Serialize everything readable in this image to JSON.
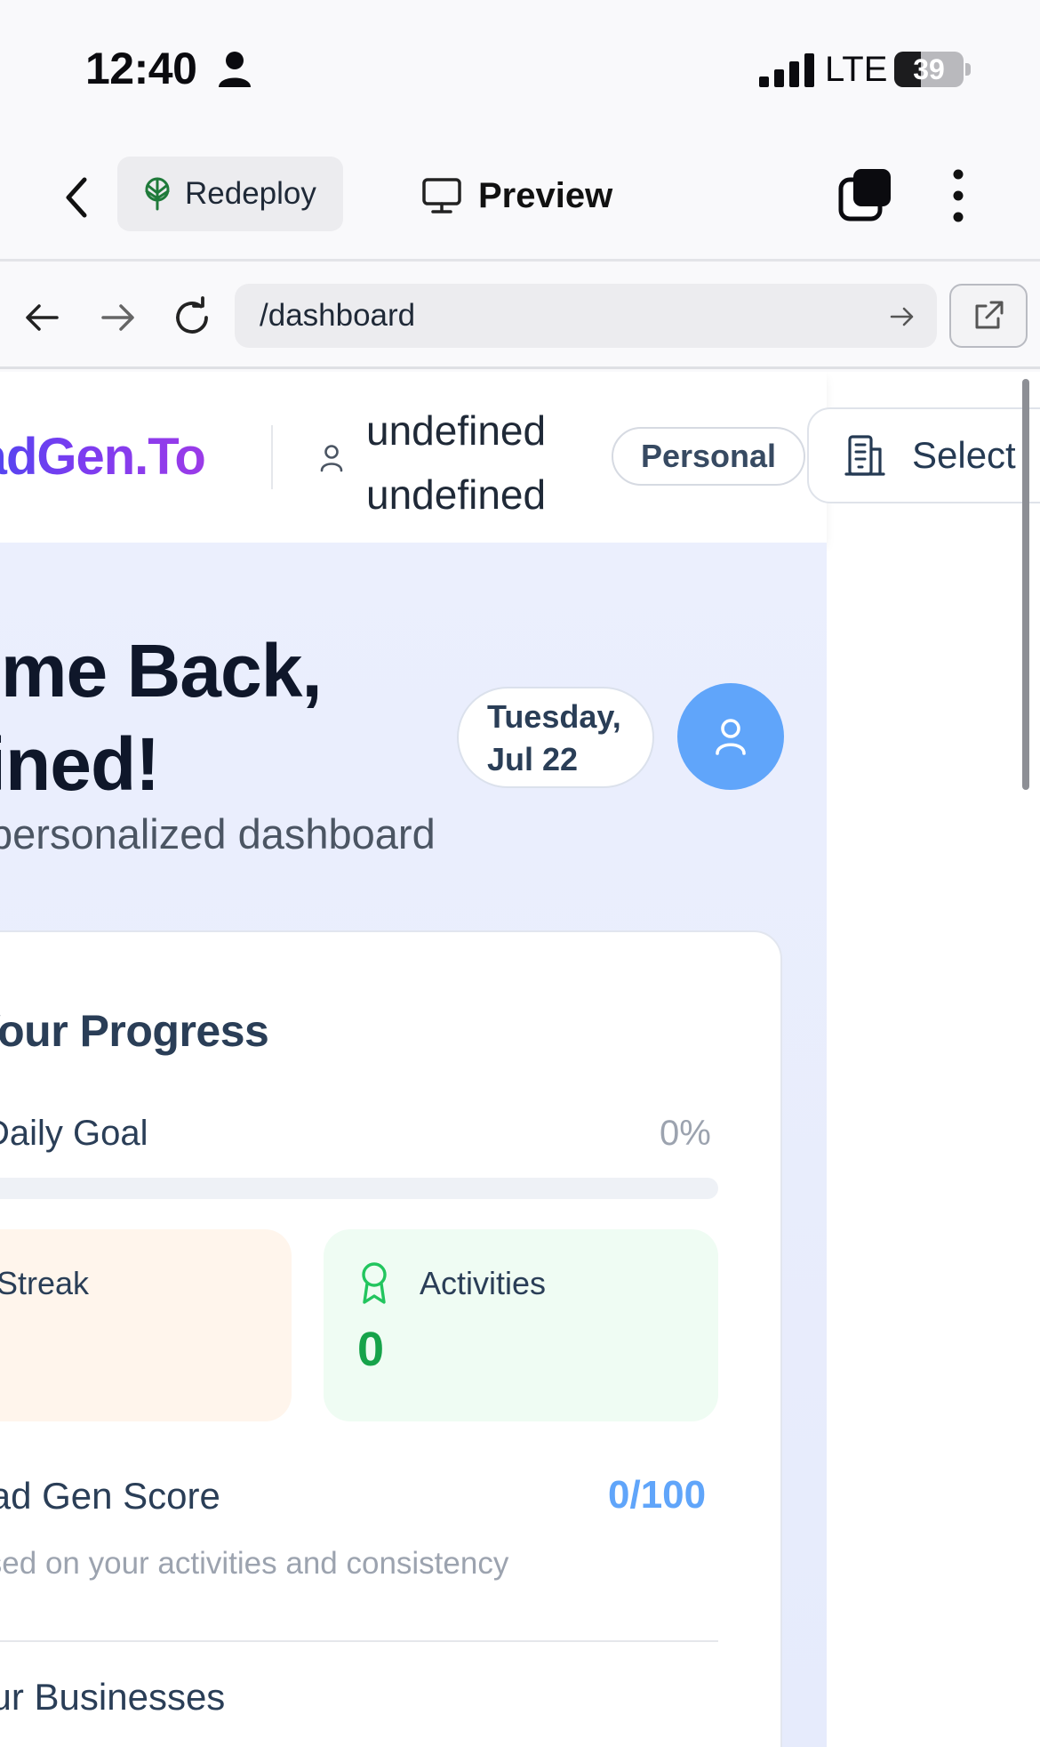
{
  "status_bar": {
    "time": "12:40",
    "network": "LTE",
    "battery": "39",
    "battery_level": 0.39
  },
  "toolbar": {
    "redeploy_label": "Redeploy",
    "preview_label": "Preview"
  },
  "browser": {
    "url": "/dashboard"
  },
  "site_header": {
    "logo": "LeadGen.To",
    "user_name_line1": "undefined",
    "user_name_line2": "undefined",
    "badge": "Personal",
    "select_label": "Select"
  },
  "hero": {
    "title_line1": "Welcome Back,",
    "title_line2": "undefined!",
    "subtitle": "Your personalized dashboard",
    "date_line1": "Tuesday,",
    "date_line2": "Jul 22"
  },
  "progress": {
    "title": "Your Progress",
    "goal_label": "Daily Goal",
    "goal_percent": "0%",
    "goal_fraction": 0,
    "streak_label": "Streak",
    "activities_label": "Activities",
    "activities_value": "0",
    "score_label": "Lead Gen Score",
    "score_value": "0/100",
    "score_description": "Based on your activities and consistency",
    "businesses_title": "Your Businesses"
  },
  "colors": {
    "accent_blue": "#60a5fa",
    "success_green": "#16a34a",
    "heading": "#2a3e57"
  }
}
